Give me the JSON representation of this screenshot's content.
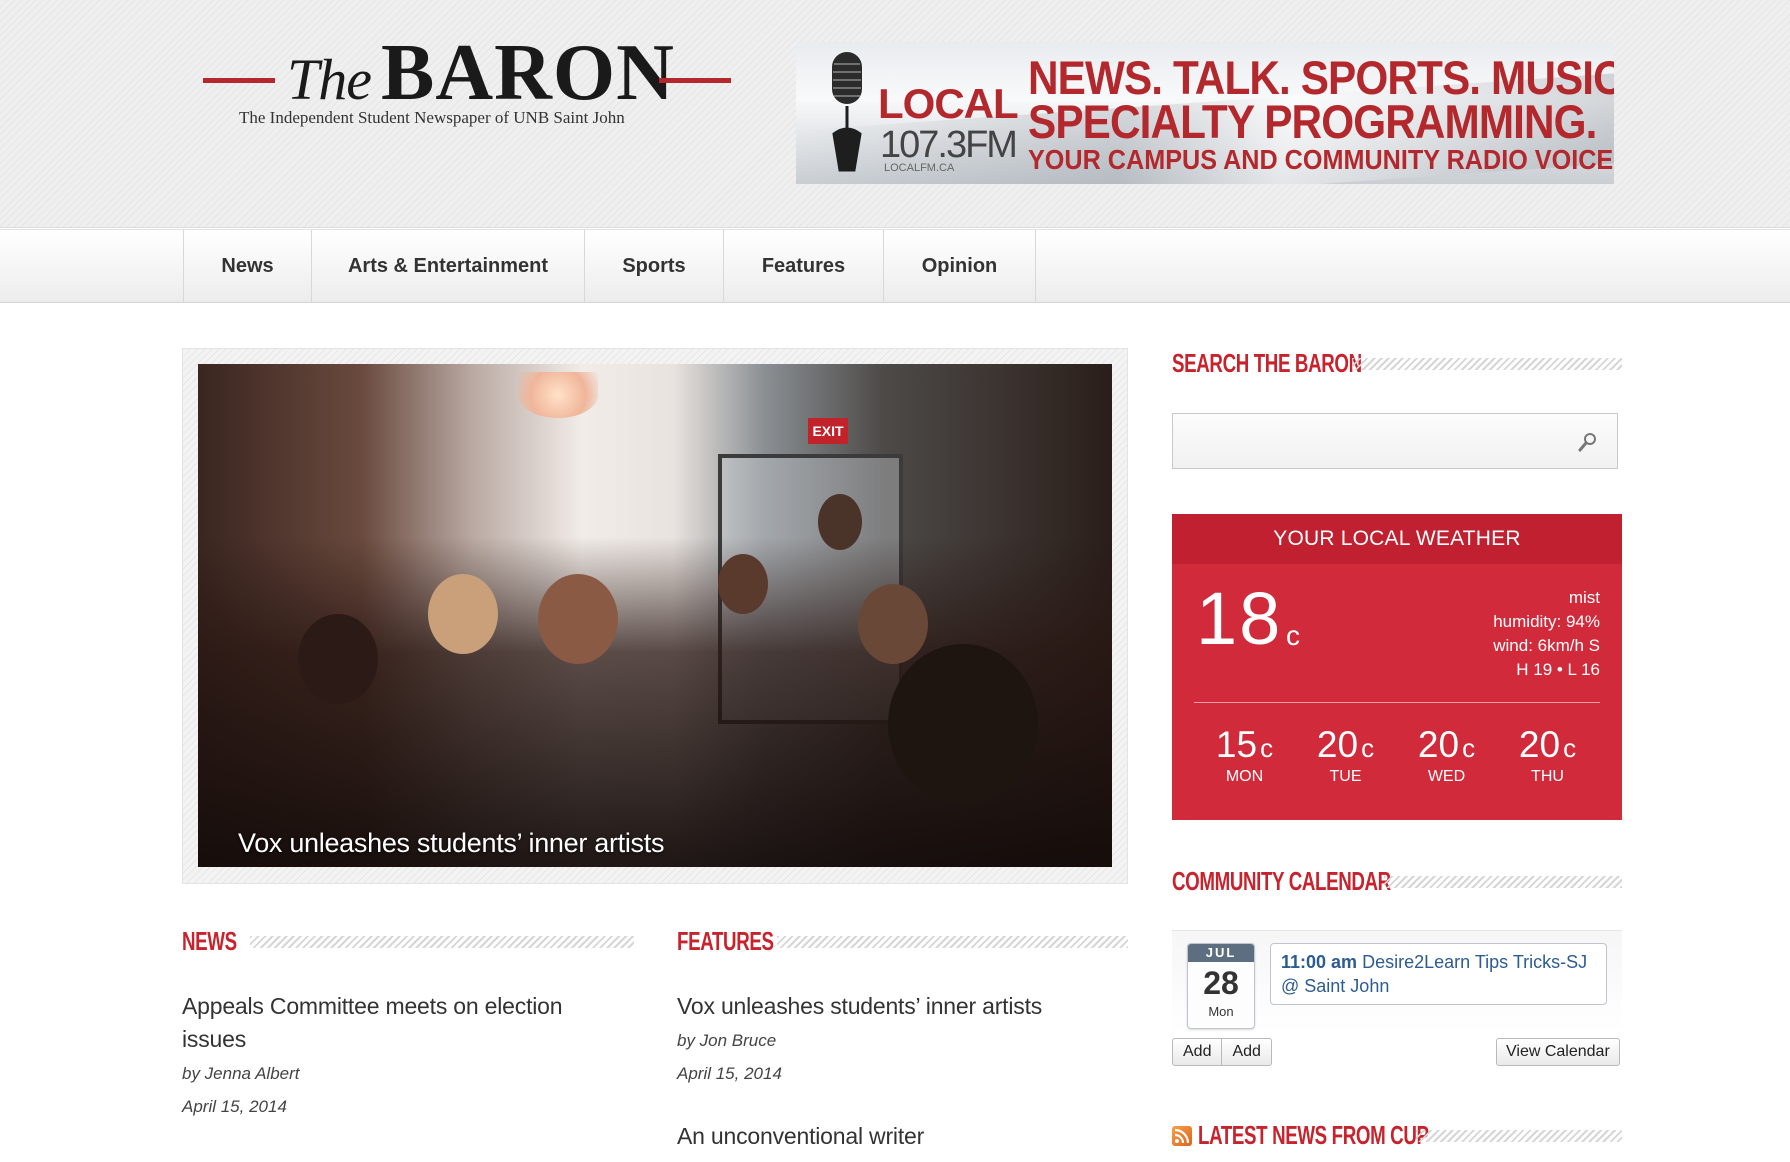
{
  "header": {
    "logo_the": "The",
    "logo_baron": "BARON",
    "tagline": "The Independent Student Newspaper of UNB Saint John"
  },
  "ad": {
    "brand": "LOCAL",
    "frequency": "107.3FM",
    "site": "LOCALFM.CA",
    "line1": "NEWS. TALK. SPORTS. MUSIC.",
    "line2": "SPECIALTY PROGRAMMING.",
    "line3": "YOUR CAMPUS AND COMMUNITY RADIO VOICE"
  },
  "nav": {
    "items": [
      {
        "label": "News"
      },
      {
        "label": "Arts & Entertainment"
      },
      {
        "label": "Sports"
      },
      {
        "label": "Features"
      },
      {
        "label": "Opinion"
      }
    ]
  },
  "featured": {
    "caption": "Vox unleashes students’ inner artists",
    "exit_sign": "EXIT"
  },
  "news_section": {
    "heading": "NEWS",
    "articles": [
      {
        "title": "Appeals Committee meets on election issues",
        "byline": "by Jenna Albert",
        "date": "April 15, 2014"
      }
    ]
  },
  "features_section": {
    "heading": "FEATURES",
    "articles": [
      {
        "title": "Vox unleashes students’ inner artists",
        "byline": "by Jon Bruce",
        "date": "April 15, 2014"
      },
      {
        "title": "An unconventional writer"
      }
    ]
  },
  "sidebar": {
    "search_heading": "SEARCH THE BARON",
    "search_value": "",
    "weather": {
      "title": "YOUR LOCAL WEATHER",
      "temp": "18",
      "unit": "c",
      "condition": "mist",
      "humidity": "humidity: 94%",
      "wind": "wind: 6km/h S",
      "hilo": "H 19 • L 16",
      "forecast": [
        {
          "temp": "15",
          "unit": "c",
          "day": "MON"
        },
        {
          "temp": "20",
          "unit": "c",
          "day": "TUE"
        },
        {
          "temp": "20",
          "unit": "c",
          "day": "WED"
        },
        {
          "temp": "20",
          "unit": "c",
          "day": "THU"
        }
      ]
    },
    "calendar": {
      "heading": "COMMUNITY CALENDAR",
      "month": "JUL",
      "day": "28",
      "weekday": "Mon",
      "event_time": "11:00 am",
      "event_title": "Desire2Learn Tips Tricks-SJ @ Saint John",
      "add_label_1": "Add",
      "add_label_2": "Add",
      "view_label": "View Calendar"
    },
    "cup_heading": "LATEST NEWS FROM CUP"
  },
  "colors": {
    "brand_red": "#c8232c",
    "weather_red": "#d12a3b",
    "link_blue": "#2c5c91"
  }
}
